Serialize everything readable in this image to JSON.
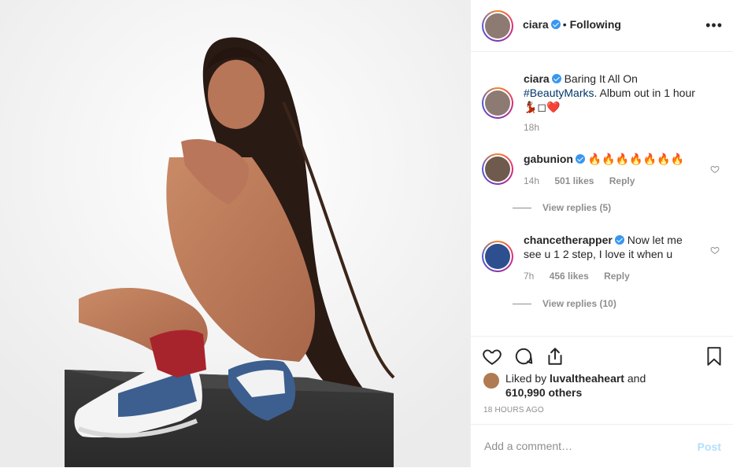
{
  "post": {
    "author": "ciara",
    "header_dot": "•",
    "following_label": "Following",
    "more_icon": "more-horizontal-icon",
    "caption": {
      "username": "ciara",
      "text_before": "Baring It All On ",
      "hashtag": "#BeautyMarks",
      "text_after": ". Album out in 1 hour 💃🏾◻❤️",
      "time": "18h"
    },
    "comments": [
      {
        "username": "gabunion",
        "text": "🔥🔥🔥🔥🔥🔥🔥",
        "time": "14h",
        "likes": "501 likes",
        "reply_label": "Reply",
        "view_replies": "View replies (5)"
      },
      {
        "username": "chancetherapper",
        "text": "Now let me see u 1 2 step, I love it when u",
        "time": "7h",
        "likes": "456 likes",
        "reply_label": "Reply",
        "view_replies": "View replies (10)"
      }
    ],
    "likes": {
      "prefix": "Liked by ",
      "user": "luvaltheaheart",
      "middle": " and ",
      "others": "610,990 others"
    },
    "timestamp": "18 HOURS AGO",
    "comment_input": {
      "placeholder": "Add a comment…"
    },
    "post_button": "Post",
    "colors": {
      "verified": "#3897f0",
      "hashtag": "#003569",
      "muted": "#8e8e8e",
      "post_disabled": "#b2dffc"
    }
  }
}
